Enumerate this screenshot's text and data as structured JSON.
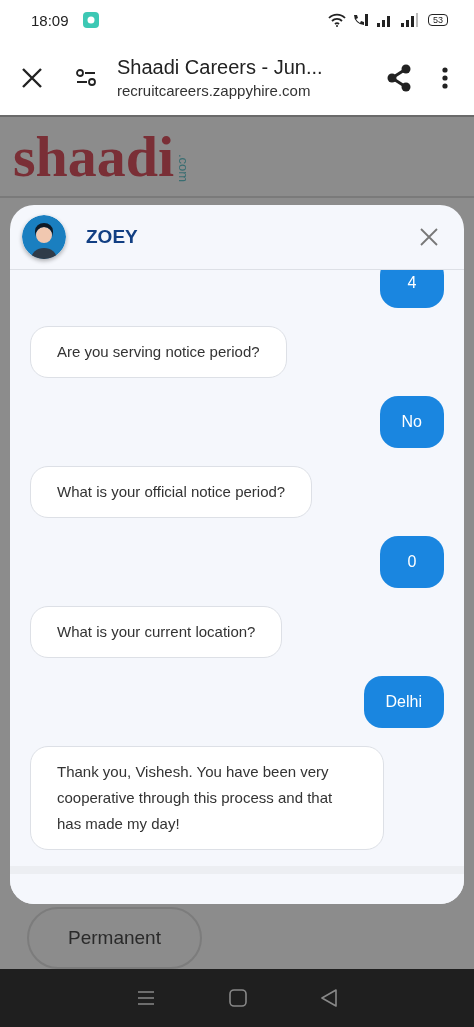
{
  "status_bar": {
    "time": "18:09",
    "battery": "53"
  },
  "browser": {
    "title": "Shaadi Careers - Jun...",
    "url": "recruitcareers.zappyhire.com"
  },
  "page": {
    "logo": "shaadi",
    "logo_suffix": ".com",
    "option": "Permanent"
  },
  "chat": {
    "bot_name": "ZOEY",
    "messages": [
      {
        "kind": "user",
        "text": "4"
      },
      {
        "kind": "bot",
        "text": "Are you serving notice period?"
      },
      {
        "kind": "user",
        "text": "No"
      },
      {
        "kind": "bot",
        "text": "What is your official notice period?"
      },
      {
        "kind": "user",
        "text": "0"
      },
      {
        "kind": "bot",
        "text": "What is your current location?"
      },
      {
        "kind": "user",
        "text": "Delhi"
      },
      {
        "kind": "bot",
        "text": "Thank you, Vishesh. You have been very cooperative through this process and that has made my day!"
      }
    ]
  }
}
